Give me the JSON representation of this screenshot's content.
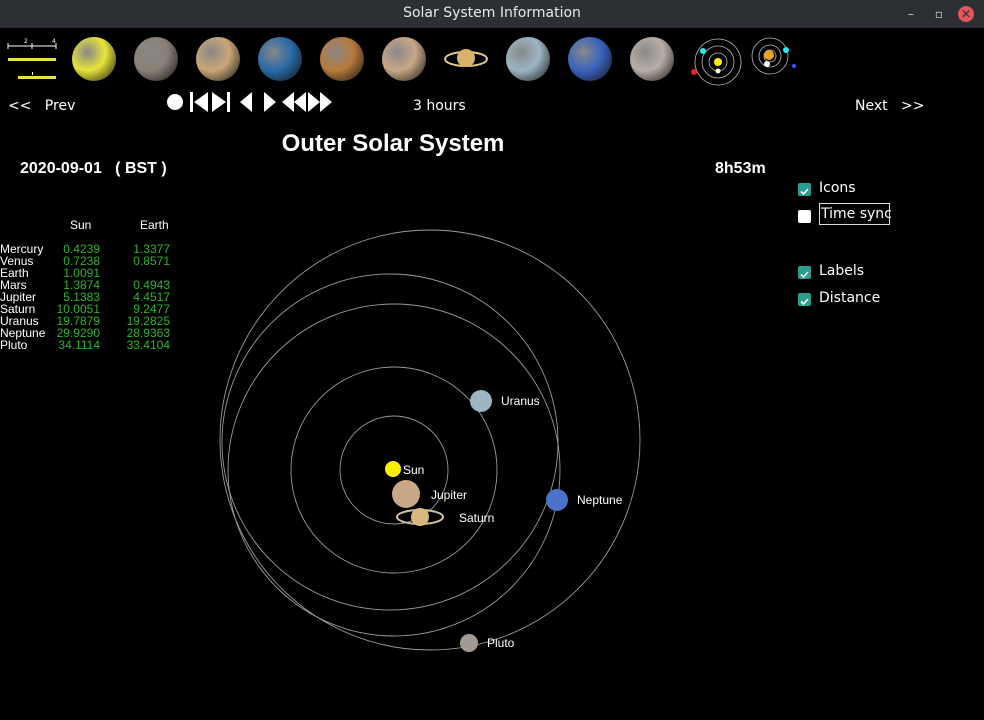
{
  "window": {
    "title": "Solar System Information",
    "minimize": "–",
    "restore": "▫",
    "close": "✕"
  },
  "toolbar": {
    "scale_ticks": [
      "2",
      "4"
    ],
    "planets": [
      {
        "name": "sun-icon",
        "color": "#e8e43a"
      },
      {
        "name": "mercury-icon",
        "color": "#8a8176"
      },
      {
        "name": "venus-icon",
        "color": "#c9a777"
      },
      {
        "name": "earth-icon",
        "color": "#2a6aa8"
      },
      {
        "name": "mars-icon",
        "color": "#b77a3a"
      },
      {
        "name": "jupiter-icon",
        "color": "#c8a886"
      },
      {
        "name": "saturn-icon",
        "color": "#d9b36a"
      },
      {
        "name": "uranus-icon",
        "color": "#9db6c4"
      },
      {
        "name": "neptune-icon",
        "color": "#3a64c0"
      },
      {
        "name": "pluto-icon",
        "color": "#b9aea6"
      }
    ],
    "inner_system_view": "inner-system-icon",
    "outer_system_view": "outer-system-icon"
  },
  "nav": {
    "prev": "<<   Prev",
    "next": "Next   >>",
    "step": "3 hours"
  },
  "view": {
    "title": "Outer Solar System",
    "date": "2020-09-01   ( BST )",
    "time": "8h53m"
  },
  "distance_table": {
    "headers": [
      "Sun",
      "Earth"
    ],
    "rows": [
      {
        "planet": "Mercury",
        "sun": "0.4239",
        "earth": "1.3377"
      },
      {
        "planet": "Venus",
        "sun": "0.7238",
        "earth": "0.8571"
      },
      {
        "planet": "Earth",
        "sun": "1.0091",
        "earth": ""
      },
      {
        "planet": "Mars",
        "sun": "1.3874",
        "earth": "0.4943"
      },
      {
        "planet": "Jupiter",
        "sun": "5.1383",
        "earth": "4.4517"
      },
      {
        "planet": "Saturn",
        "sun": "10.0051",
        "earth": "9.2477"
      },
      {
        "planet": "Uranus",
        "sun": "19.7879",
        "earth": "19.2825"
      },
      {
        "planet": "Neptune",
        "sun": "29.9290",
        "earth": "28.9363"
      },
      {
        "planet": "Pluto",
        "sun": "34.1114",
        "earth": "33.4104"
      }
    ]
  },
  "options": [
    {
      "key": "icons",
      "label": "Icons",
      "checked": true
    },
    {
      "key": "timesync",
      "label": "Time sync",
      "checked": false
    },
    {
      "key": "labels",
      "label": "Labels",
      "checked": true
    },
    {
      "key": "distance",
      "label": "Distance",
      "checked": true
    }
  ],
  "orbit_bodies": [
    {
      "name": "Sun",
      "color": "#ffee00"
    },
    {
      "name": "Jupiter",
      "color": "#c8a886"
    },
    {
      "name": "Saturn",
      "color": "#d9b880"
    },
    {
      "name": "Uranus",
      "color": "#9db6c4"
    },
    {
      "name": "Neptune",
      "color": "#4a72c8"
    },
    {
      "name": "Pluto",
      "color": "#a39a92"
    }
  ]
}
